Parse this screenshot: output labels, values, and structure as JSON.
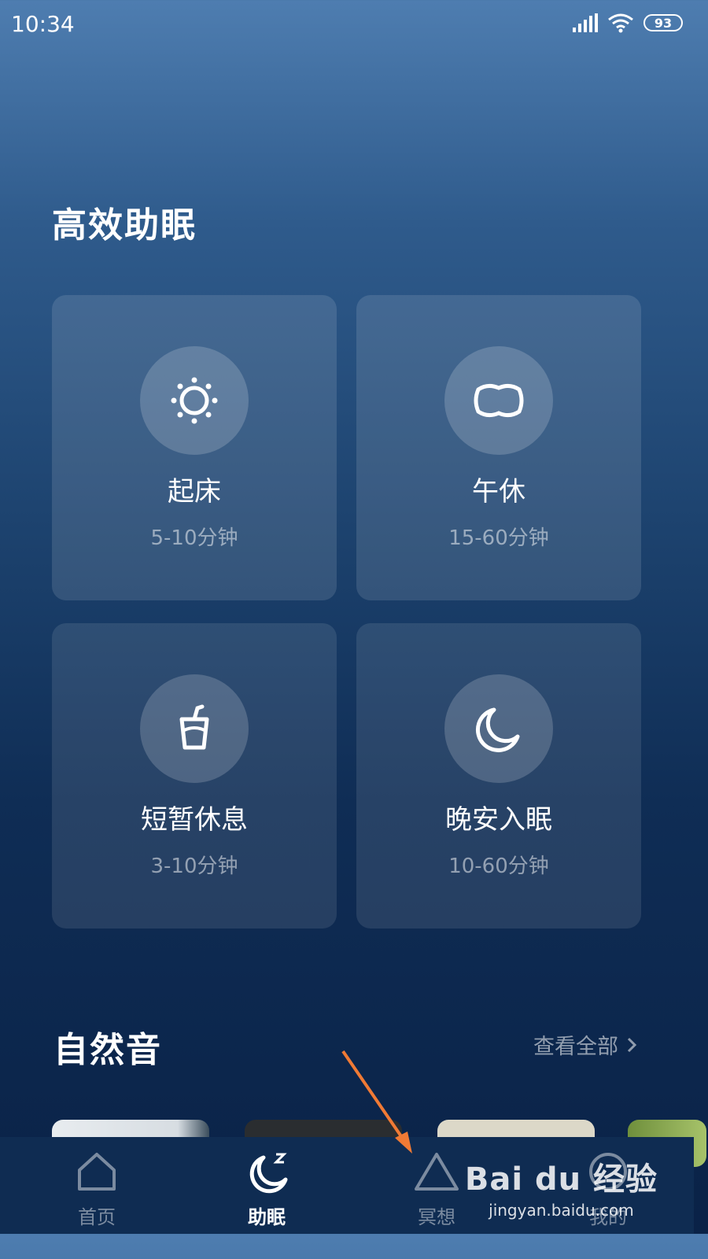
{
  "status_bar": {
    "time": "10:34",
    "battery": "93"
  },
  "sleep_section": {
    "title": "高效助眠",
    "cards": [
      {
        "label": "起床",
        "duration": "5-10分钟",
        "icon": "sun-icon"
      },
      {
        "label": "午休",
        "duration": "15-60分钟",
        "icon": "pillow-icon"
      },
      {
        "label": "短暂休息",
        "duration": "3-10分钟",
        "icon": "cup-icon"
      },
      {
        "label": "晚安入眠",
        "duration": "10-60分钟",
        "icon": "moon-icon"
      }
    ]
  },
  "nature_section": {
    "title": "自然音",
    "view_all": "查看全部"
  },
  "tabs": [
    {
      "label": "首页",
      "icon": "home-icon",
      "active": false
    },
    {
      "label": "助眠",
      "icon": "moon-sleep-icon",
      "active": true
    },
    {
      "label": "冥想",
      "icon": "triangle-icon",
      "active": false
    },
    {
      "label": "我的",
      "icon": "profile-icon",
      "active": false
    }
  ],
  "watermark": {
    "logo": "Bai du 经验",
    "url": "jingyan.baidu.com"
  },
  "colors": {
    "accent_arrow": "#f07a35",
    "background_top": "#4e7db0",
    "background_bottom": "#0a2247"
  }
}
